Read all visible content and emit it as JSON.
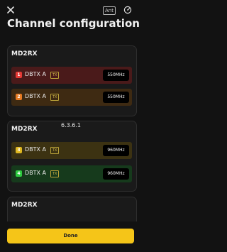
{
  "header": {
    "close_icon": "close-icon",
    "ant_label": "Ant",
    "gauge_icon": "gauge-icon",
    "title": "Channel configuration"
  },
  "devices": [
    {
      "name": "MD2RX",
      "channels": [
        {
          "number": "1",
          "name": "DBTX A",
          "tx_label": "TX",
          "frequency": "550MHz",
          "color": "#e53935"
        },
        {
          "number": "2",
          "name": "DBTX A",
          "tx_label": "TX",
          "frequency": "550MHz",
          "color": "#e67a22"
        }
      ]
    },
    {
      "name": "MD2RX",
      "channels": [
        {
          "number": "3",
          "name": "DBTX A",
          "tx_label": "TX",
          "frequency": "960MHz",
          "color": "#e0b820"
        },
        {
          "number": "4",
          "name": "DBTX A",
          "tx_label": "TX",
          "frequency": "960MHz",
          "color": "#2ecc40"
        }
      ]
    },
    {
      "name": "MD2RX",
      "channels": []
    }
  ],
  "version": "6.3.6.1",
  "done_label": "Done",
  "colors": {
    "accent": "#f5c518",
    "background": "#121212",
    "card": "#1a1a1a"
  }
}
